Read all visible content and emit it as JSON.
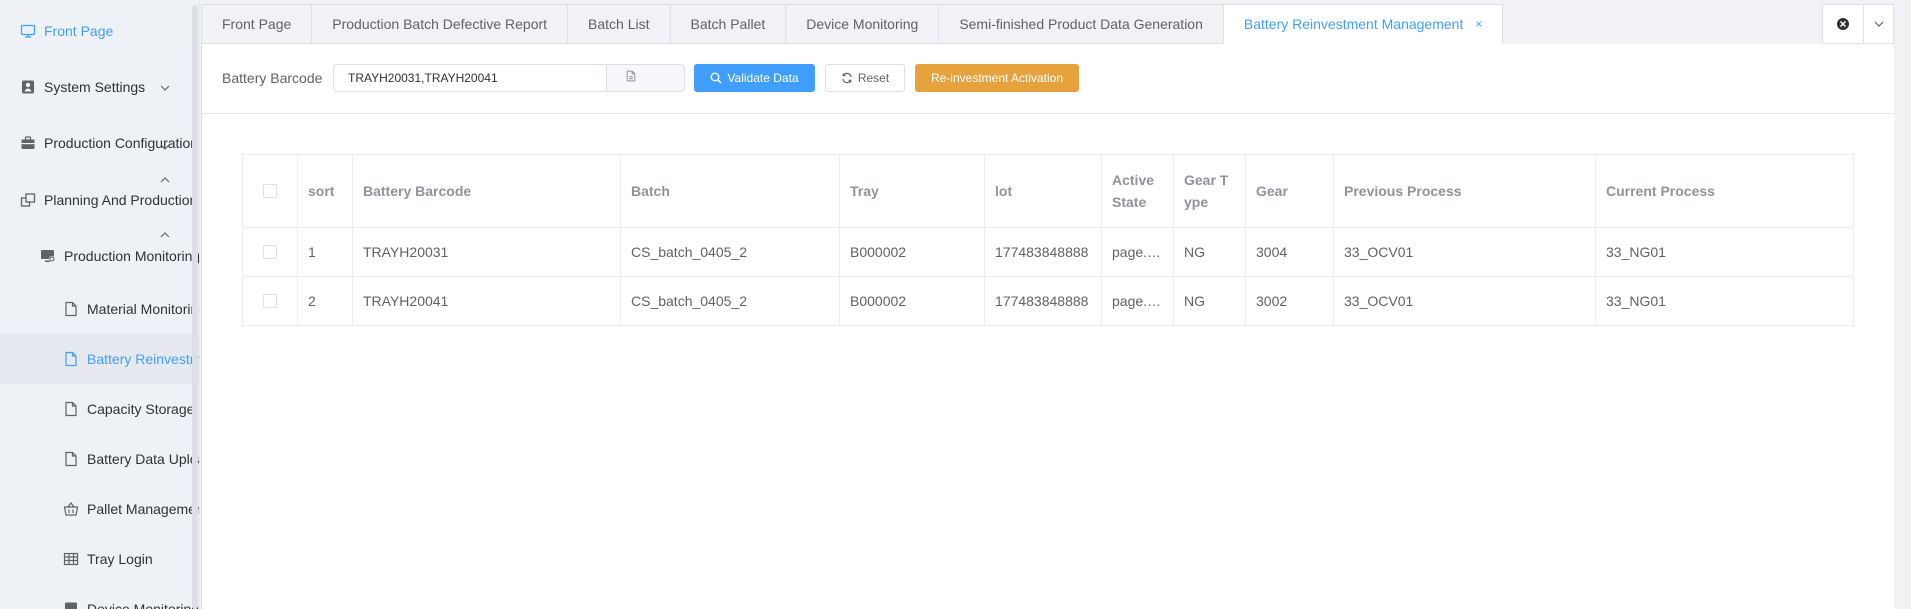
{
  "sidebar": {
    "items": [
      {
        "label": "Front Page",
        "icon": "monitor-icon"
      },
      {
        "label": "System Settings",
        "icon": "user-settings-icon"
      },
      {
        "label": "Production Configuration",
        "icon": "briefcase-icon"
      },
      {
        "label": "Planning And Production",
        "icon": "windows-icon"
      },
      {
        "label": "Production Monitoring",
        "icon": "monitor-gear-icon"
      },
      {
        "label": "Material Monitoring",
        "icon": "document-icon"
      },
      {
        "label": "Battery Reinvestment",
        "icon": "document-icon"
      },
      {
        "label": "Capacity Storage L",
        "icon": "document-icon"
      },
      {
        "label": "Battery Data Upload",
        "icon": "document-icon"
      },
      {
        "label": "Pallet Management",
        "icon": "basket-icon"
      },
      {
        "label": "Tray Login",
        "icon": "grid-icon"
      },
      {
        "label": "Device Monitoring",
        "icon": "device-icon"
      }
    ]
  },
  "tabs": [
    {
      "label": "Front Page"
    },
    {
      "label": "Production Batch Defective Report"
    },
    {
      "label": "Batch List"
    },
    {
      "label": "Batch Pallet"
    },
    {
      "label": "Device Monitoring"
    },
    {
      "label": "Semi-finished Product Data Generation"
    },
    {
      "label": "Battery Reinvestment Management",
      "close": "×"
    }
  ],
  "filter": {
    "label": "Battery Barcode",
    "value": "TRAYH20031,TRAYH20041",
    "validate_label": "Validate Data",
    "reset_label": "Reset",
    "activate_label": "Re-investment Activation"
  },
  "table": {
    "headers": [
      "sort",
      "Battery Barcode",
      "Batch",
      "Tray",
      "lot",
      "Active State",
      "Gear T ype",
      "Gear",
      "Previous Process",
      "Current Process"
    ],
    "rows": [
      {
        "sort": "1",
        "barcode": "TRAYH20031",
        "batch": "CS_batch_0405_2",
        "tray": "B000002",
        "lot": "177483848888",
        "active": "page.…",
        "gear_type": "NG",
        "gear": "3004",
        "prev": "33_OCV01",
        "curr": "33_NG01"
      },
      {
        "sort": "2",
        "barcode": "TRAYH20041",
        "batch": "CS_batch_0405_2",
        "tray": "B000002",
        "lot": "177483848888",
        "active": "page.…",
        "gear_type": "NG",
        "gear": "3002",
        "prev": "33_OCV01",
        "curr": "33_NG01"
      }
    ]
  },
  "colors": {
    "primary": "#409eff",
    "warning": "#e6a23c"
  }
}
